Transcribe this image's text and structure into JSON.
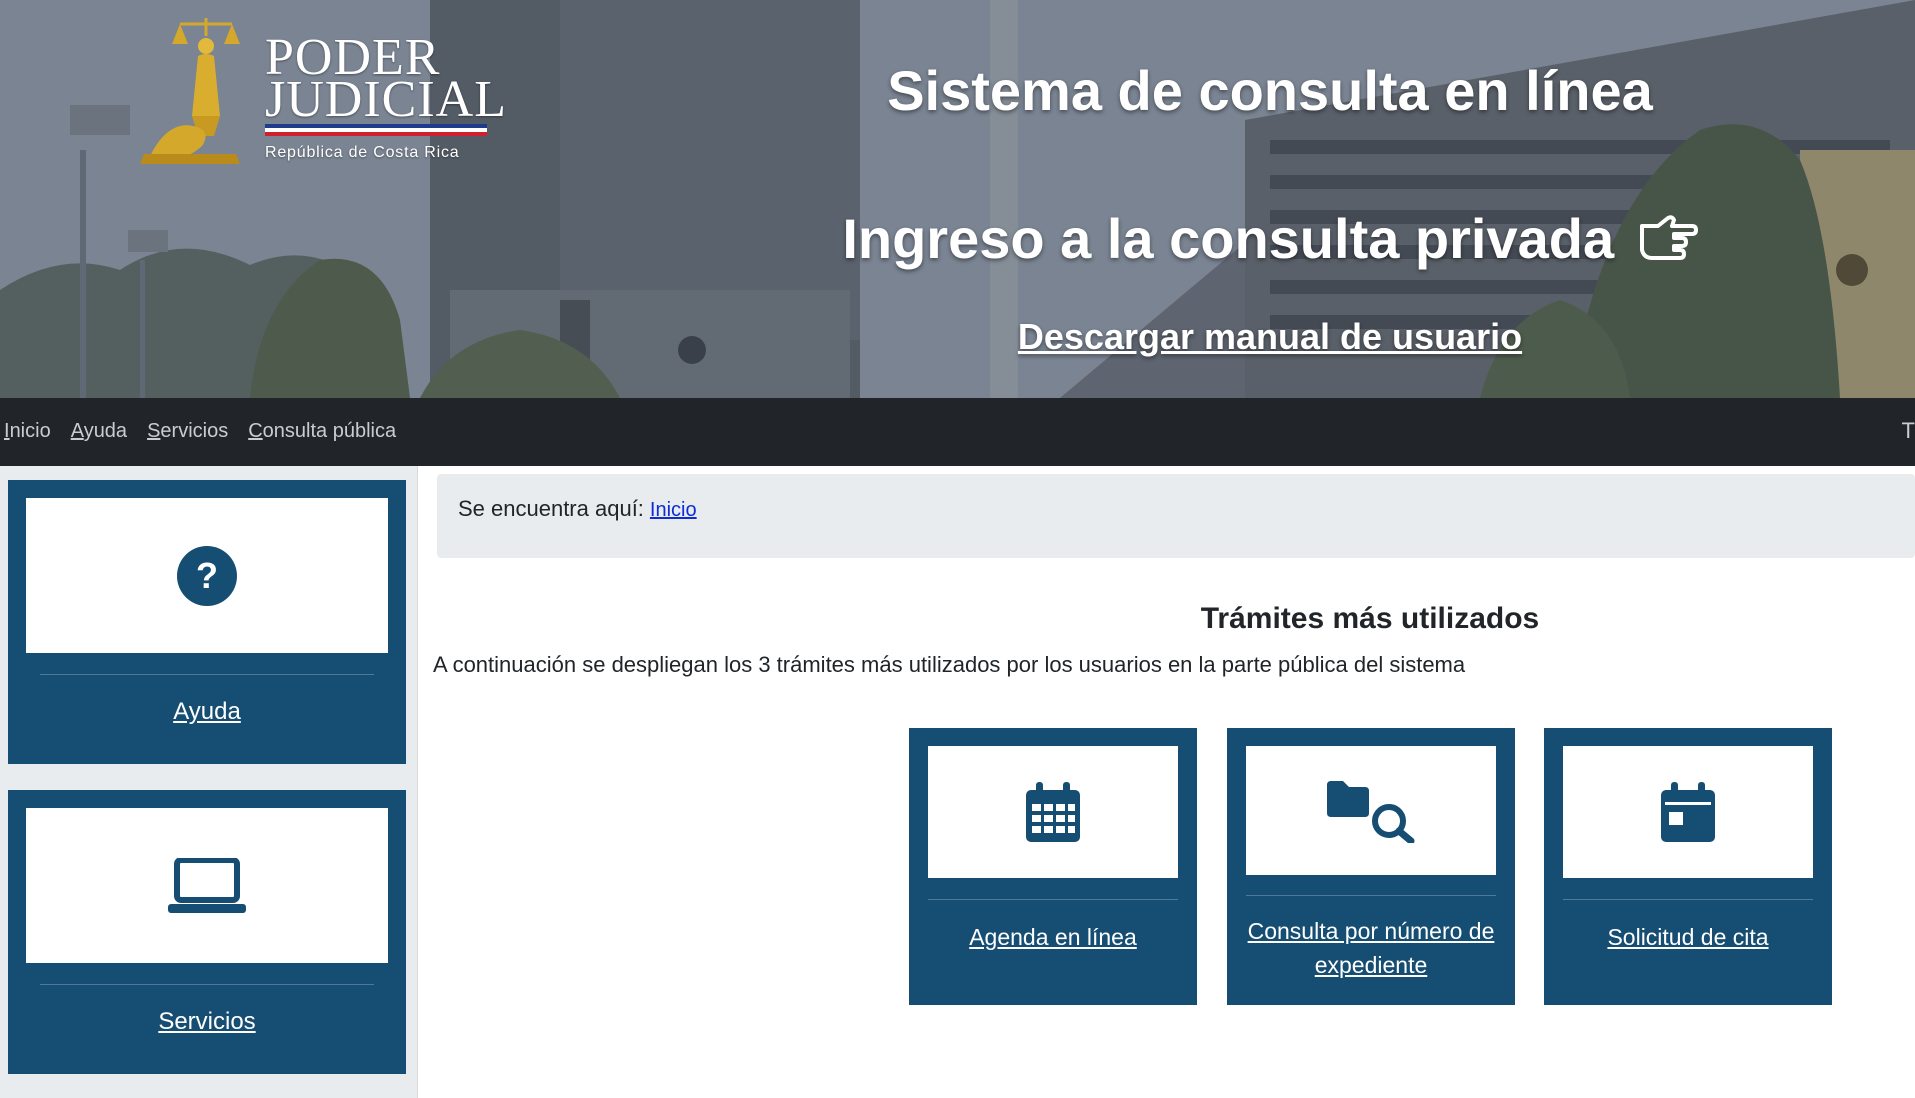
{
  "banner": {
    "logo": {
      "word1": "PODER",
      "word2": "JUDICIAL",
      "subtitle": "República de Costa Rica"
    },
    "title": "Sistema de consulta en línea",
    "subtitle": "Ingreso a la consulta privada",
    "subtitle_icon": "pointing-hand-icon",
    "manual_link": "Descargar manual de usuario"
  },
  "nav": {
    "items": [
      {
        "underline": "I",
        "rest": "nicio"
      },
      {
        "underline": "A",
        "rest": "yuda"
      },
      {
        "underline": "S",
        "rest": "ervicios"
      },
      {
        "underline": "C",
        "rest": "onsulta pública"
      }
    ],
    "right_partial": "T"
  },
  "sidebar": {
    "cards": [
      {
        "label": "Ayuda",
        "icon": "question-circle-icon"
      },
      {
        "label": "Servicios",
        "icon": "laptop-icon"
      }
    ]
  },
  "breadcrumb": {
    "prefix": "Se encuentra aquí:",
    "link": "Inicio"
  },
  "main": {
    "section_title": "Trámites más utilizados",
    "description": "A continuación se despliegan los 3 trámites más utilizados por los usuarios en la parte pública del sistema",
    "cards": [
      {
        "label": "Agenda en línea",
        "icon": "calendar-grid-icon"
      },
      {
        "label": "Consulta por número de expediente",
        "icon": "folder-search-icon"
      },
      {
        "label": "Solicitud de cita",
        "icon": "calendar-day-icon"
      }
    ]
  },
  "colors": {
    "primary": "#164d72",
    "navbar": "#212529",
    "panel": "#e9ecef",
    "link": "#0d2bd6"
  }
}
